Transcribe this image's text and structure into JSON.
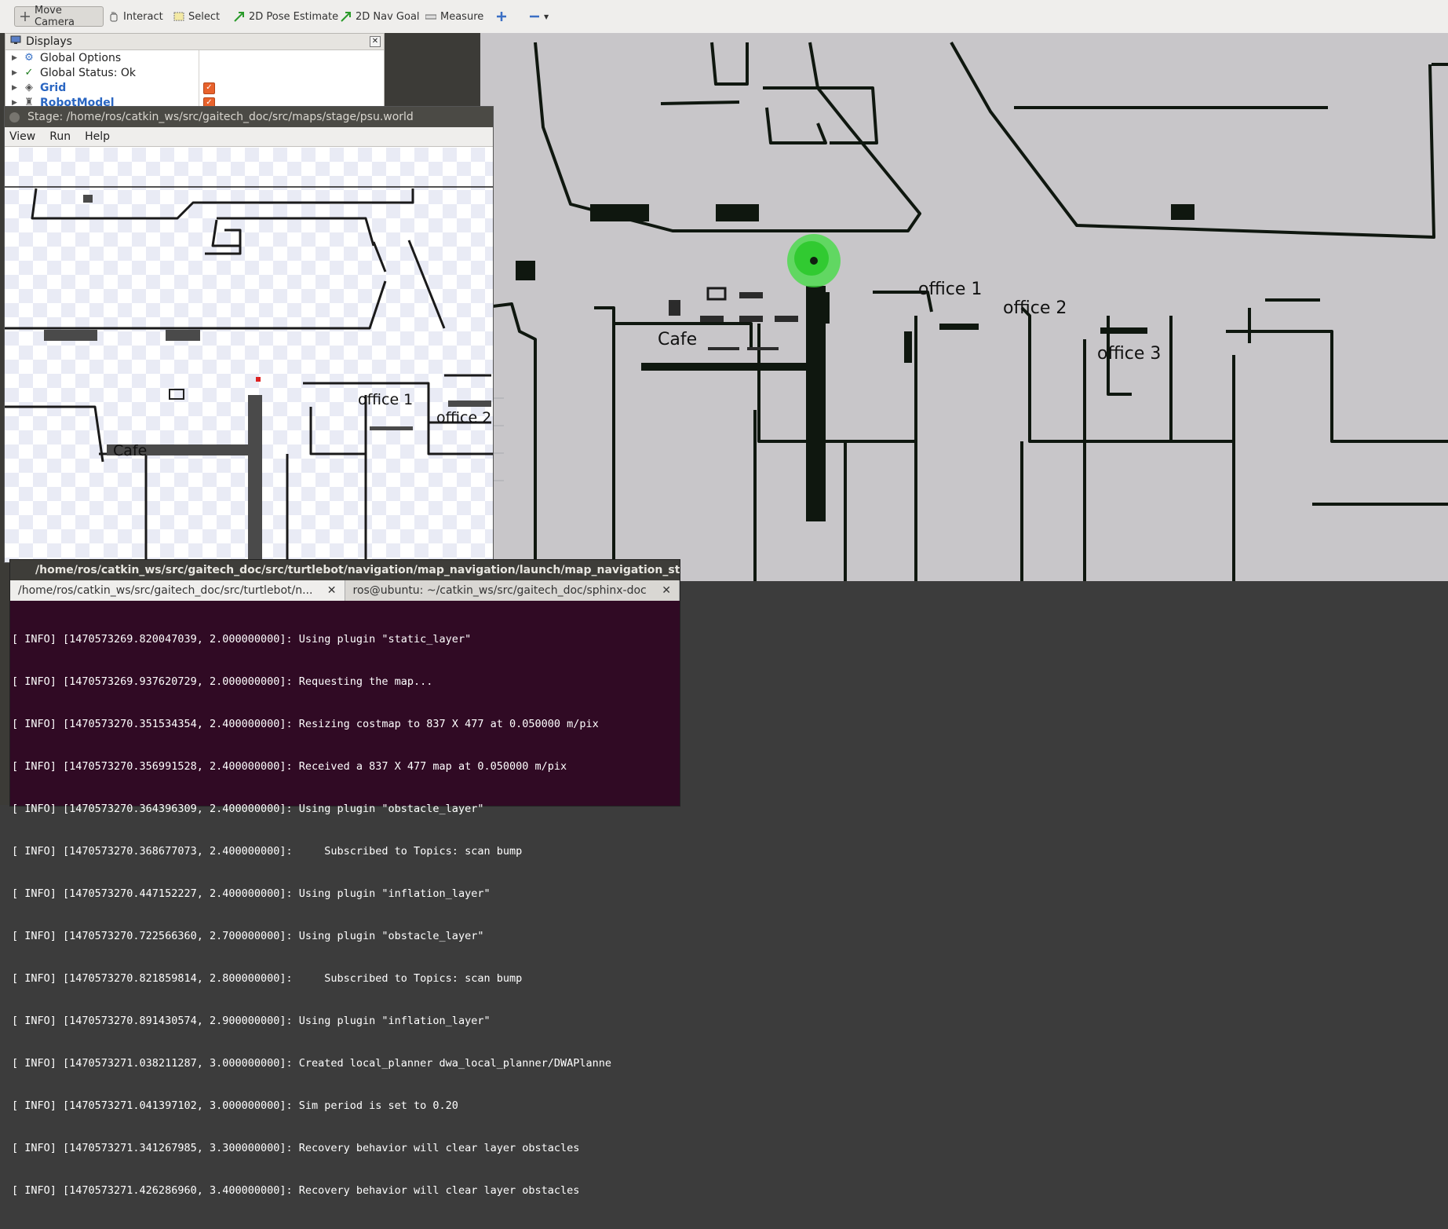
{
  "toolbar": {
    "tools": [
      "Move Camera",
      "Interact",
      "Select",
      "2D Pose Estimate",
      "2D Nav Goal",
      "Measure"
    ]
  },
  "displays": {
    "title": "Displays",
    "items": [
      {
        "label": "Global Options",
        "icon": "gear-icon"
      },
      {
        "label": "Global Status: Ok",
        "icon": "checkmark-icon"
      },
      {
        "label": "Grid",
        "icon": "grid-icon",
        "checked": true
      },
      {
        "label": "RobotModel",
        "icon": "robot-icon",
        "checked": true
      }
    ]
  },
  "stage": {
    "title": "Stage: /home/ros/catkin_ws/src/gaitech_doc/src/maps/stage/psu.world",
    "menu": [
      "View",
      "Run",
      "Help"
    ],
    "labels": [
      "Cafe",
      "office 1",
      "office 2"
    ]
  },
  "map": {
    "labels": [
      "Cafe",
      "office 1",
      "office 2",
      "office 3"
    ]
  },
  "terminal": {
    "title": "/home/ros/catkin_ws/src/gaitech_doc/src/turtlebot/navigation/map_navigation/launch/map_navigation_stag",
    "tabs": [
      "/home/ros/catkin_ws/src/gaitech_doc/src/turtlebot/n...",
      "ros@ubuntu: ~/catkin_ws/src/gaitech_doc/sphinx-doc"
    ],
    "lines": [
      "[ INFO] [1470573269.820047039, 2.000000000]: Using plugin \"static_layer\"",
      "[ INFO] [1470573269.937620729, 2.000000000]: Requesting the map...",
      "[ INFO] [1470573270.351534354, 2.400000000]: Resizing costmap to 837 X 477 at 0.050000 m/pix",
      "[ INFO] [1470573270.356991528, 2.400000000]: Received a 837 X 477 map at 0.050000 m/pix",
      "[ INFO] [1470573270.364396309, 2.400000000]: Using plugin \"obstacle_layer\"",
      "[ INFO] [1470573270.368677073, 2.400000000]:     Subscribed to Topics: scan bump",
      "[ INFO] [1470573270.447152227, 2.400000000]: Using plugin \"inflation_layer\"",
      "[ INFO] [1470573270.722566360, 2.700000000]: Using plugin \"obstacle_layer\"",
      "[ INFO] [1470573270.821859814, 2.800000000]:     Subscribed to Topics: scan bump",
      "[ INFO] [1470573270.891430574, 2.900000000]: Using plugin \"inflation_layer\"",
      "[ INFO] [1470573271.038211287, 3.000000000]: Created local_planner dwa_local_planner/DWAPlanne",
      "[ INFO] [1470573271.041397102, 3.000000000]: Sim period is set to 0.20",
      "[ INFO] [1470573271.341267985, 3.300000000]: Recovery behavior will clear layer obstacles",
      "[ INFO] [1470573271.426286960, 3.400000000]: Recovery behavior will clear layer obstacles"
    ]
  }
}
